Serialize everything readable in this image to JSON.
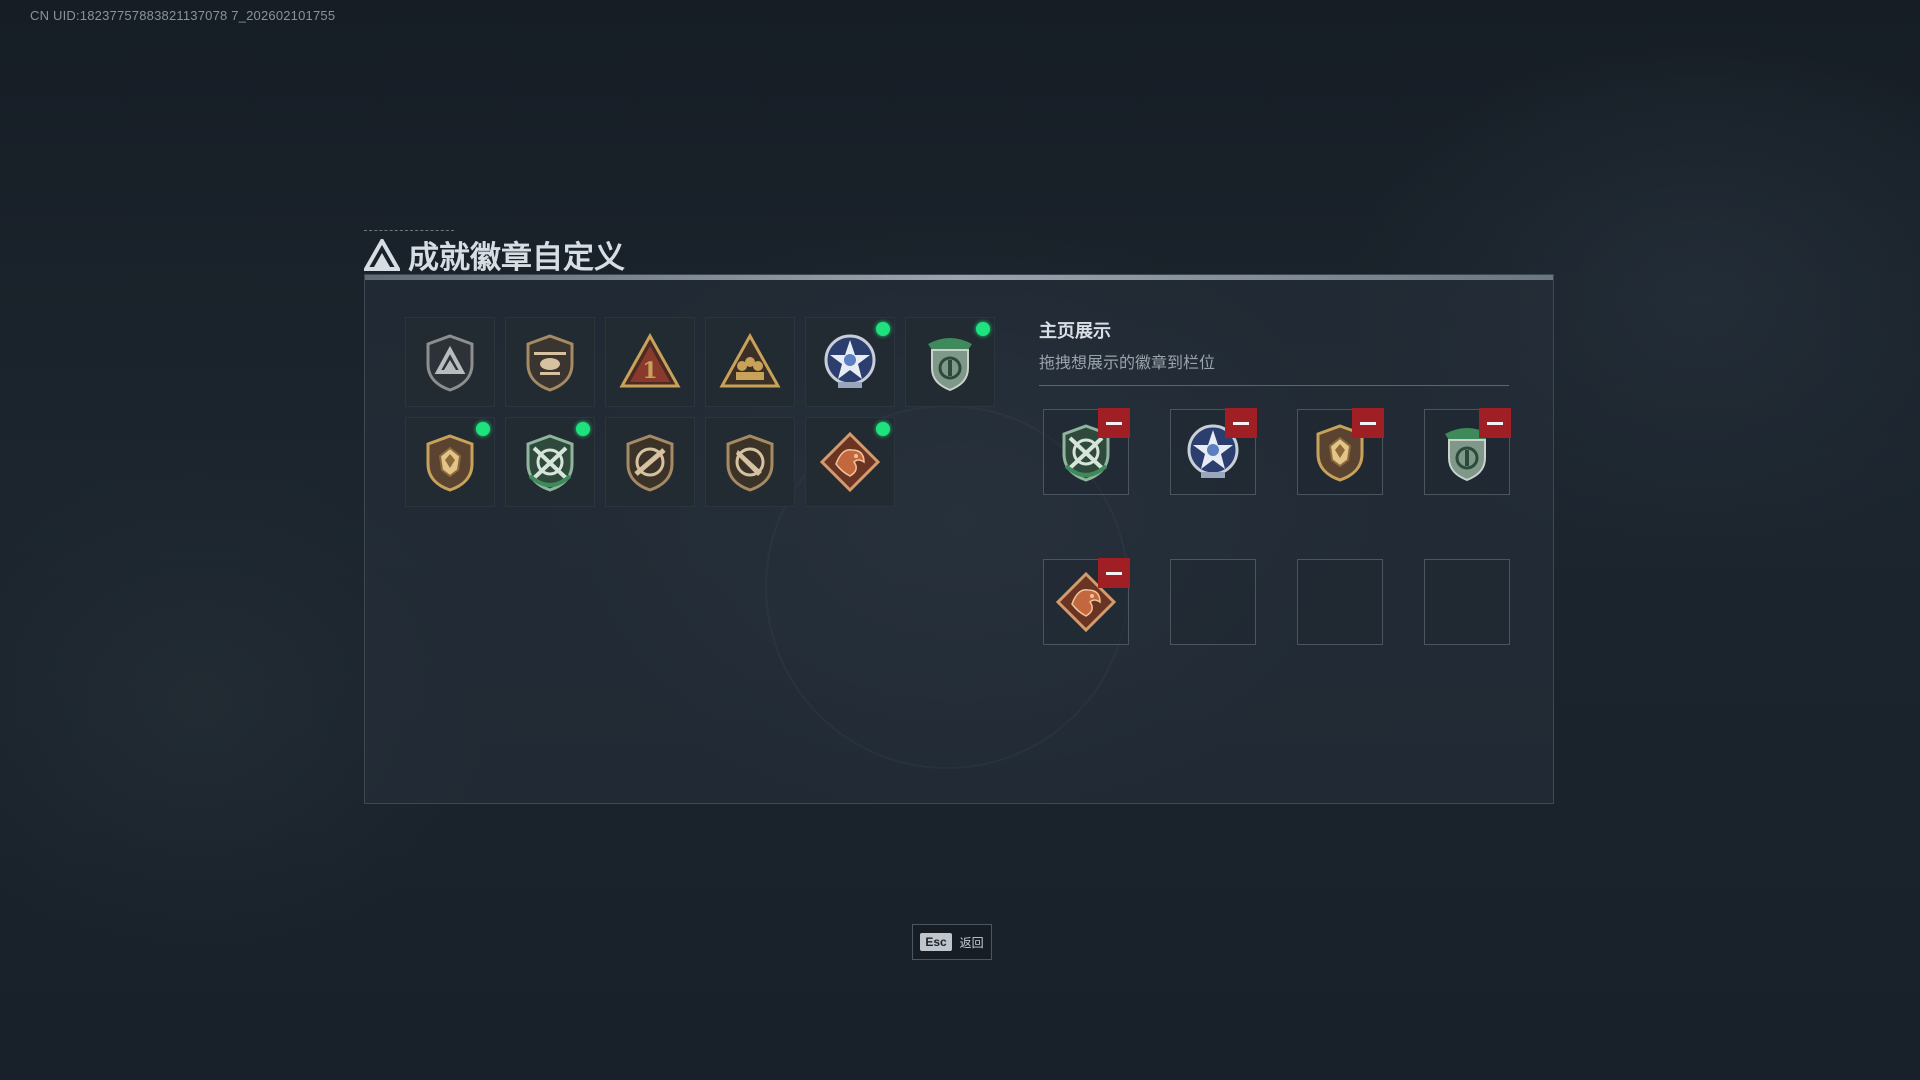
{
  "uid_text": "CN UID:18237757883821137078 7_202602101755",
  "title": "成就徽章自定义",
  "badges": [
    {
      "icon": "triangle-shield-badge-icon",
      "equipped": false
    },
    {
      "icon": "helicopter-shield-badge-icon",
      "equipped": false
    },
    {
      "icon": "number-one-triangle-badge-icon",
      "equipped": false
    },
    {
      "icon": "squad-triangle-badge-icon",
      "equipped": false
    },
    {
      "icon": "blue-star-medal-badge-icon",
      "equipped": true
    },
    {
      "icon": "green-shield-beret-badge-icon",
      "equipped": true
    },
    {
      "icon": "gold-crest-shield-badge-icon",
      "equipped": true
    },
    {
      "icon": "green-crossed-rifles-badge-icon",
      "equipped": true
    },
    {
      "icon": "rifle-shield-badge-icon",
      "equipped": false
    },
    {
      "icon": "knife-shield-badge-icon",
      "equipped": false
    },
    {
      "icon": "dragon-diamond-badge-icon",
      "equipped": true
    }
  ],
  "showcase": {
    "title": "主页展示",
    "subtitle": "拖拽想展示的徽章到栏位",
    "slots": [
      {
        "icon": "green-crossed-rifles-badge-icon",
        "filled": true
      },
      {
        "icon": "blue-star-medal-badge-icon",
        "filled": true
      },
      {
        "icon": "gold-crest-shield-badge-icon",
        "filled": true
      },
      {
        "icon": "green-shield-beret-badge-icon",
        "filled": true
      },
      {
        "icon": "dragon-diamond-badge-icon",
        "filled": true
      },
      {
        "icon": "",
        "filled": false
      },
      {
        "icon": "",
        "filled": false
      },
      {
        "icon": "",
        "filled": false
      }
    ]
  },
  "footer": {
    "esc_key": "Esc",
    "back_label": "返回"
  },
  "colors": {
    "equipped_dot": "#1ee27d",
    "remove_button": "#a01f24",
    "gold": "#c9a25a",
    "green": "#3e8a5a",
    "blue": "#5b7fc0",
    "dragon": "#c3673f"
  }
}
